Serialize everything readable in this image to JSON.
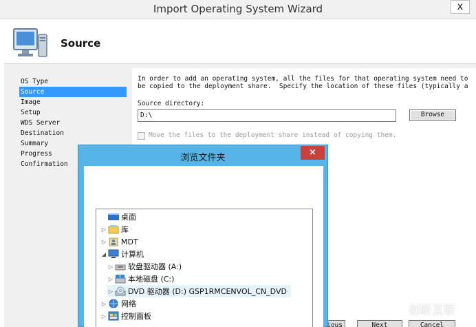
{
  "window": {
    "title": "Import Operating System Wizard",
    "close_glyph": "x"
  },
  "header": {
    "heading": "Source",
    "icon": "monitor-icon"
  },
  "nav": {
    "items": [
      {
        "label": "OS Type",
        "selected": false
      },
      {
        "label": "Source",
        "selected": true
      },
      {
        "label": "Image",
        "selected": false
      },
      {
        "label": "Setup",
        "selected": false
      },
      {
        "label": "WDS Server",
        "selected": false
      },
      {
        "label": "Destination",
        "selected": false
      },
      {
        "label": "Summary",
        "selected": false
      },
      {
        "label": "Progress",
        "selected": false
      },
      {
        "label": "Confirmation",
        "selected": false
      }
    ]
  },
  "content": {
    "intro_line1": "In order to add an operating system, all the files for that operating system need to",
    "intro_line2": "be copied to the deployment share.  Specify the location of these files (typically a",
    "source_label": "Source directory:",
    "source_value": "D:\\",
    "browse_label": "Browse",
    "move_label": "Move the files to the deployment share instead of copying them.",
    "move_checked": false
  },
  "footer": {
    "previous_label": "ious",
    "next_label": "Next",
    "cancel_label": "Cancel"
  },
  "browse_dialog": {
    "title": "浏览文件夹",
    "close_glyph": "×",
    "tree": [
      {
        "label": "桌面",
        "expander": "",
        "icon": "desktop-icon",
        "selected": false
      },
      {
        "label": "库",
        "expander": "▷",
        "icon": "libraries-icon",
        "selected": false
      },
      {
        "label": "MDT",
        "expander": "▷",
        "icon": "user-folder-icon",
        "selected": false
      },
      {
        "label": "计算机",
        "expander": "◢",
        "icon": "computer-icon",
        "selected": false
      },
      {
        "label": "软盘驱动器 (A:)",
        "expander": "▷",
        "icon": "floppy-drive-icon",
        "selected": false
      },
      {
        "label": "本地磁盘 (C:)",
        "expander": "▷",
        "icon": "local-disk-icon",
        "selected": false
      },
      {
        "label": "DVD 驱动器 (D:) GSP1RMCENVOL_CN_DVD",
        "expander": "▷",
        "icon": "dvd-drive-icon",
        "selected": true
      },
      {
        "label": "网络",
        "expander": "▷",
        "icon": "network-icon",
        "selected": false
      },
      {
        "label": "控制面板",
        "expander": "▷",
        "icon": "control-panel-icon",
        "selected": false
      }
    ]
  },
  "watermark": {
    "text": "创新互联"
  },
  "colors": {
    "selection": "#3399ff",
    "dialog_frame": "#57b4e8",
    "dialog_close": "#c7423a"
  }
}
